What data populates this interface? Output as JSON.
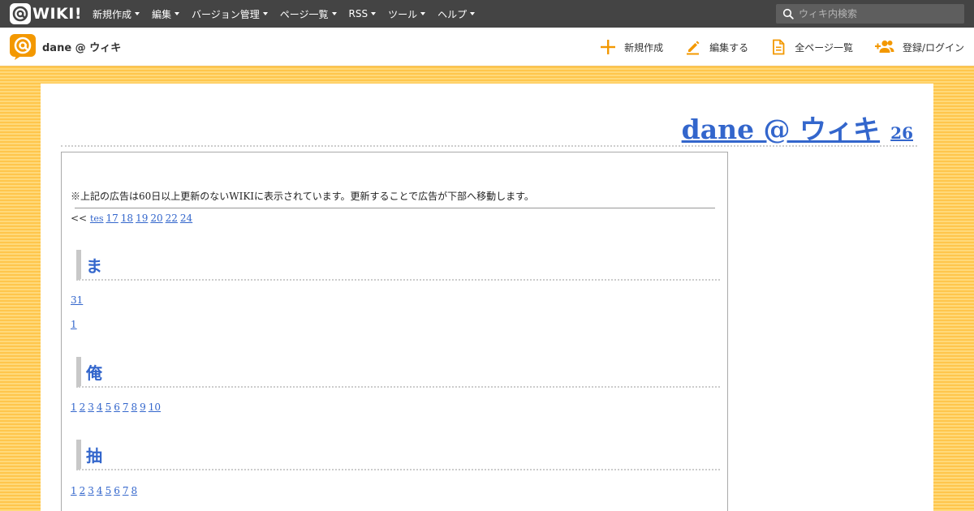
{
  "topbar": {
    "logo_text": "WIKI!",
    "menu": [
      "新規作成",
      "編集",
      "バージョン管理",
      "ページ一覧",
      "RSS",
      "ツール",
      "ヘルプ"
    ],
    "search_placeholder": "ウィキ内検索"
  },
  "header": {
    "site_title": "dane @ ウィキ",
    "actions": [
      {
        "label": "新規作成",
        "icon": "plus-icon"
      },
      {
        "label": "編集する",
        "icon": "pencil-icon"
      },
      {
        "label": "全ページ一覧",
        "icon": "document-icon"
      },
      {
        "label": "登録/ログイン",
        "icon": "user-add-icon"
      }
    ]
  },
  "page": {
    "title": "dane @ ウィキ",
    "title_count": "26",
    "notice": "※上記の広告は60日以上更新のないWIKIに表示されています。更新することで広告が下部へ移動します。",
    "pager_prefix": "<<",
    "pager_links": [
      "tes",
      "17",
      "18",
      "19",
      "20",
      "22",
      "24"
    ],
    "sections": [
      {
        "heading": "ま",
        "rows": [
          [
            "31"
          ],
          [
            "1"
          ]
        ]
      },
      {
        "heading": "俺",
        "rows": [
          [
            "1",
            "2",
            "3",
            "4",
            "5",
            "6",
            "7",
            "8",
            "9",
            "10"
          ]
        ]
      },
      {
        "heading": "抽",
        "rows": [
          [
            "1",
            "2",
            "3",
            "4",
            "5",
            "6",
            "7",
            "8"
          ]
        ]
      }
    ]
  },
  "colors": {
    "topbar_bg": "#444444",
    "accent": "#f39800",
    "link": "#3366cc",
    "background_stripe": "#ffc64c"
  }
}
